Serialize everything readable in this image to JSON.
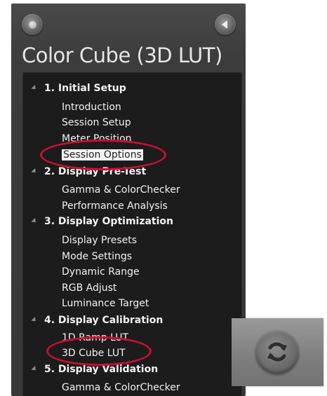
{
  "panel": {
    "title": "Color Cube (3D LUT)"
  },
  "tree": {
    "sections": [
      {
        "label": "1. Initial Setup",
        "items": [
          "Introduction",
          "Session Setup",
          "Meter Position",
          "Session Options"
        ]
      },
      {
        "label": "2. Display Pre-Test",
        "items": [
          "Gamma & ColorChecker",
          "Performance Analysis"
        ]
      },
      {
        "label": "3. Display Optimization",
        "items": [
          "Display Presets",
          "Mode Settings",
          "Dynamic Range",
          "RGB Adjust",
          "Luminance Target"
        ]
      },
      {
        "label": "4. Display Calibration",
        "items": [
          "1D Ramp LUT",
          "3D Cube LUT"
        ]
      },
      {
        "label": "5. Display Validation",
        "items": [
          "Gamma & ColorChecker"
        ]
      }
    ],
    "selected_item": "Session Options"
  },
  "icons": {
    "left_button": "dot-icon",
    "right_button": "back-arrow-icon",
    "refresh": "refresh-icon"
  },
  "colors": {
    "highlight_oval": "#c8102e",
    "panel_bg": "#3c3c3c",
    "tree_bg": "#1c1c1c"
  }
}
